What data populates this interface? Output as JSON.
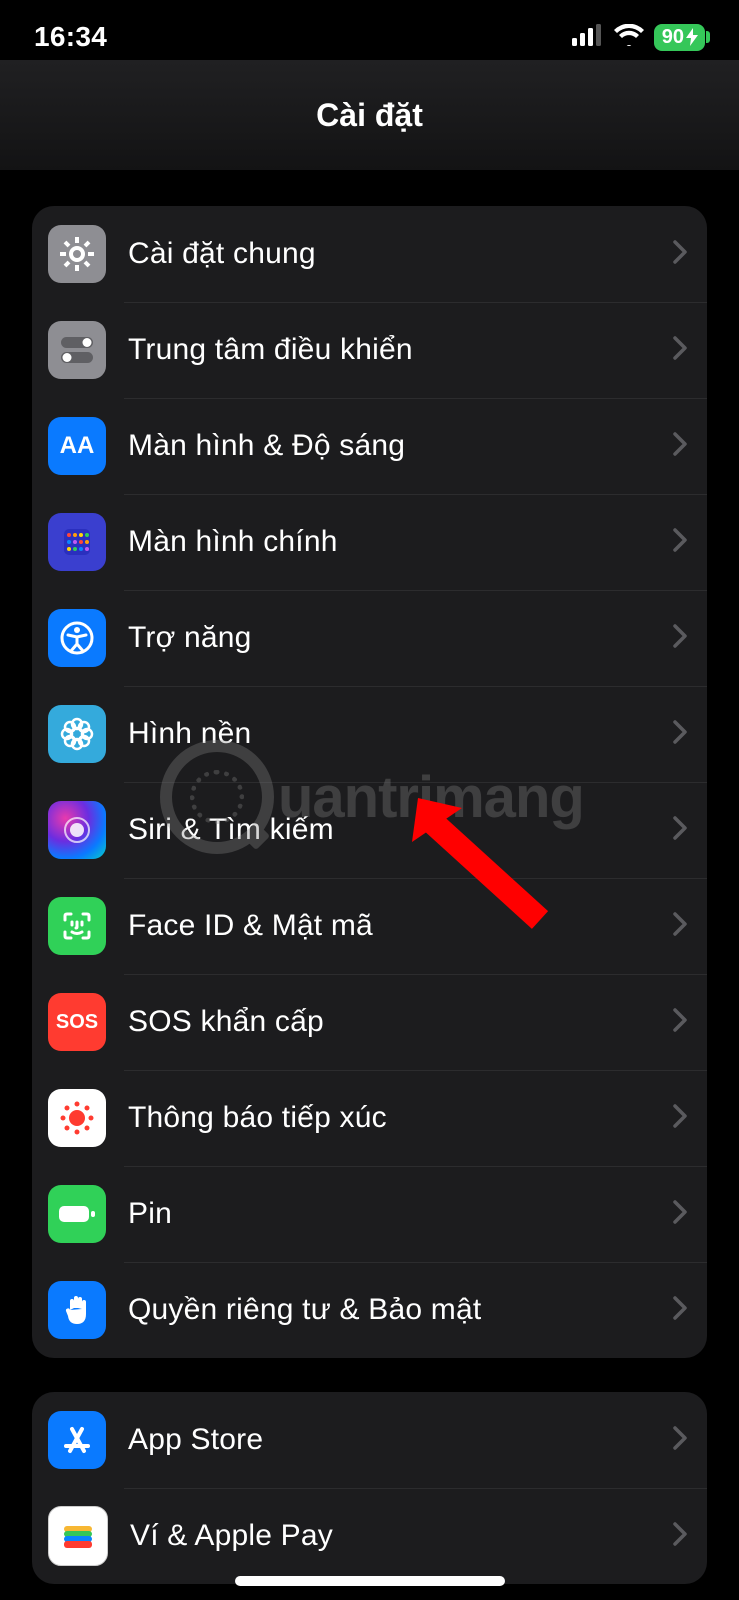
{
  "status": {
    "time": "16:34",
    "battery_pct": "90"
  },
  "header": {
    "title": "Cài đặt"
  },
  "group1": [
    {
      "id": "general",
      "label": "Cài đặt chung"
    },
    {
      "id": "control",
      "label": "Trung tâm điều khiển"
    },
    {
      "id": "display",
      "label": "Màn hình & Độ sáng"
    },
    {
      "id": "home",
      "label": "Màn hình chính"
    },
    {
      "id": "access",
      "label": "Trợ năng"
    },
    {
      "id": "wallpaper",
      "label": "Hình nền"
    },
    {
      "id": "siri",
      "label": "Siri & Tìm kiếm"
    },
    {
      "id": "faceid",
      "label": "Face ID & Mật mã"
    },
    {
      "id": "sos",
      "label": "SOS khẩn cấp"
    },
    {
      "id": "exposure",
      "label": "Thông báo tiếp xúc"
    },
    {
      "id": "battery",
      "label": "Pin"
    },
    {
      "id": "privacy",
      "label": "Quyền riêng tư & Bảo mật"
    }
  ],
  "group2": [
    {
      "id": "appstore",
      "label": "App Store"
    },
    {
      "id": "wallet",
      "label": "Ví & Apple Pay"
    }
  ],
  "watermark": {
    "text": "uantrimang"
  },
  "sos_text": "SOS",
  "display_icon_text": "AA"
}
